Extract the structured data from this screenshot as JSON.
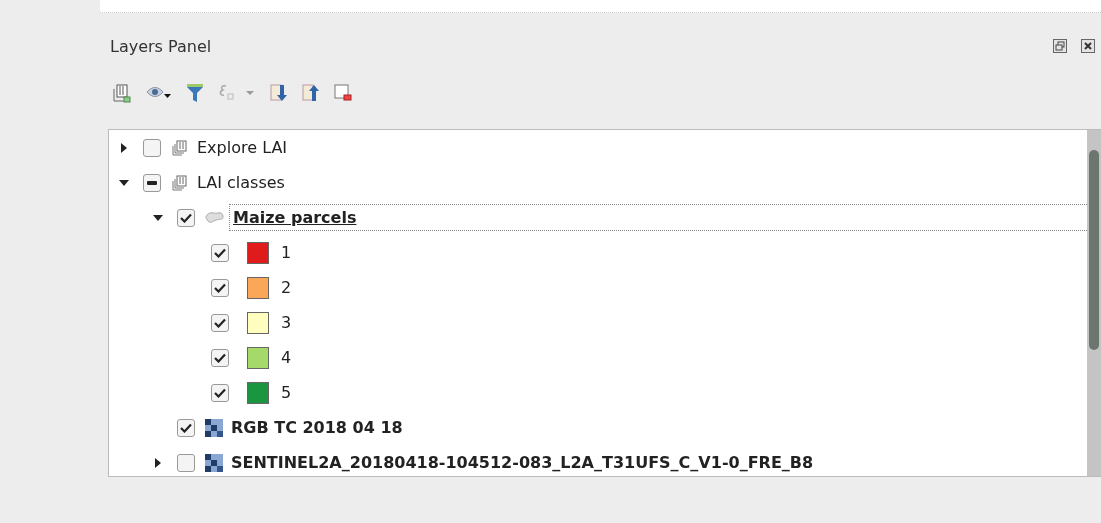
{
  "panel": {
    "title": "Layers Panel"
  },
  "layers": [
    {
      "kind": "group",
      "label": "Explore LAI",
      "checked": false,
      "expanded": false
    },
    {
      "kind": "group",
      "label": "LAI classes",
      "partial": true,
      "expanded": true,
      "children": [
        {
          "kind": "vector",
          "label": "Maize parcels",
          "checked": true,
          "expanded": true,
          "current": true,
          "children": [
            {
              "kind": "class",
              "label": "1",
              "checked": true,
              "color": "#e01b1b"
            },
            {
              "kind": "class",
              "label": "2",
              "checked": true,
              "color": "#fba75a"
            },
            {
              "kind": "class",
              "label": "3",
              "checked": true,
              "color": "#fffebf"
            },
            {
              "kind": "class",
              "label": "4",
              "checked": true,
              "color": "#a5d96a"
            },
            {
              "kind": "class",
              "label": "5",
              "checked": true,
              "color": "#1a9641"
            }
          ]
        },
        {
          "kind": "raster",
          "label": "RGB TC 2018 04 18",
          "checked": true,
          "current": false
        },
        {
          "kind": "raster",
          "label": "SENTINEL2A_20180418-104512-083_L2A_T31UFS_C_V1-0_FRE_B8",
          "checked": false,
          "expanded": false,
          "current": false
        }
      ]
    }
  ]
}
